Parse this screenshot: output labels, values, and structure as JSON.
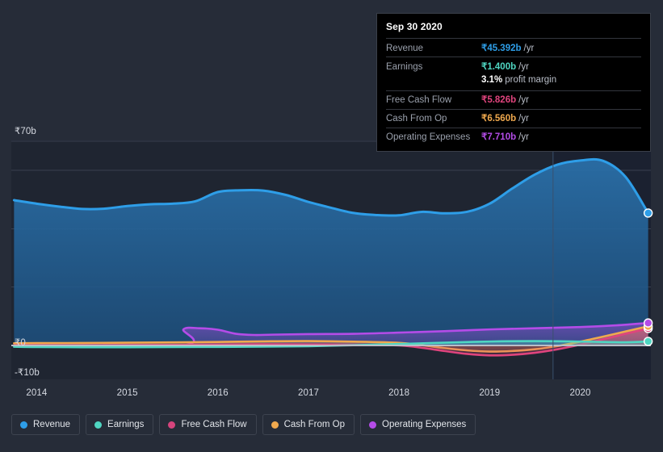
{
  "chart_data": {
    "type": "area",
    "title": "",
    "xlabel": "",
    "ylabel": "",
    "currency_symbol": "₹",
    "ylim": [
      -10,
      70
    ],
    "y_ticks": [
      {
        "label": "₹70b",
        "value": 70
      },
      {
        "label": "₹0",
        "value": 0
      },
      {
        "label": "-₹10b",
        "value": -10
      }
    ],
    "gridlines": [
      70,
      60,
      40,
      20,
      0
    ],
    "x_ticks": [
      "2014",
      "2015",
      "2016",
      "2017",
      "2018",
      "2019",
      "2020"
    ],
    "x_range": [
      "2013.7",
      "2020.75"
    ],
    "legend_position": "bottom-left",
    "forecast_divider_year": "2019.7",
    "series": [
      {
        "name": "Revenue",
        "color": "#2e9ee8",
        "fill": "rgba(46,110,168,0.55)",
        "x": [
          2013.75,
          2014.0,
          2014.25,
          2014.5,
          2014.75,
          2015.0,
          2015.25,
          2015.5,
          2015.75,
          2016.0,
          2016.25,
          2016.5,
          2016.75,
          2017.0,
          2017.25,
          2017.5,
          2017.75,
          2018.0,
          2018.25,
          2018.5,
          2018.75,
          2019.0,
          2019.25,
          2019.5,
          2019.75,
          2020.0,
          2020.25,
          2020.5,
          2020.75
        ],
        "values": [
          49.8,
          48.6,
          47.6,
          46.8,
          46.9,
          47.8,
          48.4,
          48.6,
          49.4,
          52.6,
          53.2,
          53.1,
          51.6,
          49.2,
          47.2,
          45.4,
          44.7,
          44.6,
          45.8,
          45.3,
          45.8,
          48.6,
          53.8,
          58.6,
          62.0,
          63.4,
          63.3,
          57.8,
          45.392
        ]
      },
      {
        "name": "Earnings",
        "color": "#4fd6c2",
        "fill": "rgba(79,214,194,0.25)",
        "x": [
          2013.75,
          2014.0,
          2014.5,
          2015.0,
          2015.5,
          2016.0,
          2016.5,
          2017.0,
          2017.5,
          2018.0,
          2018.5,
          2019.0,
          2019.5,
          2020.0,
          2020.5,
          2020.75
        ],
        "values": [
          -0.45,
          -0.55,
          -0.6,
          -0.6,
          -0.55,
          -0.5,
          -0.4,
          -0.25,
          0.1,
          0.5,
          0.95,
          1.35,
          1.5,
          1.35,
          1.1,
          1.4
        ]
      },
      {
        "name": "Free Cash Flow",
        "color": "#e0447d",
        "fill": "rgba(224,68,125,0.22)",
        "x": [
          2013.75,
          2014.0,
          2014.5,
          2015.0,
          2015.5,
          2016.0,
          2016.5,
          2017.0,
          2017.5,
          2018.0,
          2018.25,
          2018.5,
          2018.75,
          2019.0,
          2019.25,
          2019.5,
          2019.75,
          2020.0,
          2020.25,
          2020.5,
          2020.75
        ],
        "values": [
          0.1,
          0.1,
          0.1,
          0.15,
          0.2,
          0.3,
          0.4,
          0.35,
          0.25,
          0.0,
          -0.8,
          -1.9,
          -2.9,
          -3.4,
          -3.2,
          -2.5,
          -1.3,
          0.3,
          2.1,
          4.0,
          5.826
        ]
      },
      {
        "name": "Cash From Op",
        "color": "#f0a94e",
        "fill": "rgba(240,169,78,0.22)",
        "x": [
          2013.75,
          2014.0,
          2014.5,
          2015.0,
          2015.5,
          2016.0,
          2016.5,
          2017.0,
          2017.5,
          2018.0,
          2018.25,
          2018.5,
          2018.75,
          2019.0,
          2019.25,
          2019.5,
          2019.75,
          2020.0,
          2020.25,
          2020.5,
          2020.75
        ],
        "values": [
          0.75,
          0.8,
          0.85,
          0.95,
          1.05,
          1.2,
          1.4,
          1.5,
          1.3,
          0.9,
          0.1,
          -0.9,
          -1.7,
          -2.1,
          -1.9,
          -1.3,
          -0.2,
          1.3,
          3.0,
          4.8,
          6.56
        ]
      },
      {
        "name": "Operating Expenses",
        "color": "#b44ce8",
        "fill": "rgba(120,72,170,0.6)",
        "x": [
          2013.75,
          2015.6,
          2015.62,
          2015.8,
          2016.0,
          2016.2,
          2016.4,
          2016.6,
          2017.0,
          2017.5,
          2018.0,
          2018.5,
          2019.0,
          2019.5,
          2020.0,
          2020.4,
          2020.75
        ],
        "values": [
          0,
          0,
          5.5,
          5.9,
          5.4,
          4.0,
          3.6,
          3.7,
          3.9,
          4.0,
          4.4,
          4.9,
          5.5,
          5.9,
          6.3,
          6.9,
          7.71
        ]
      }
    ]
  },
  "tooltip": {
    "title": "Sep 30 2020",
    "unit_suffix": "/yr",
    "rows": [
      {
        "key": "Revenue",
        "value": "₹45.392b",
        "color": "#2e9ee8"
      },
      {
        "key": "Earnings",
        "value": "₹1.400b",
        "color": "#4fd6c2"
      },
      {
        "key": "Free Cash Flow",
        "value": "₹5.826b",
        "color": "#e0447d"
      },
      {
        "key": "Cash From Op",
        "value": "₹6.560b",
        "color": "#f0a94e"
      },
      {
        "key": "Operating Expenses",
        "value": "₹7.710b",
        "color": "#b44ce8"
      }
    ],
    "profit_margin": {
      "value": "3.1%",
      "label": "profit margin"
    }
  },
  "legend": {
    "items": [
      {
        "label": "Revenue",
        "color": "#2e9ee8"
      },
      {
        "label": "Earnings",
        "color": "#4fd6c2"
      },
      {
        "label": "Free Cash Flow",
        "color": "#d6447d"
      },
      {
        "label": "Cash From Op",
        "color": "#f0a94e"
      },
      {
        "label": "Operating Expenses",
        "color": "#b44ce8"
      }
    ]
  }
}
